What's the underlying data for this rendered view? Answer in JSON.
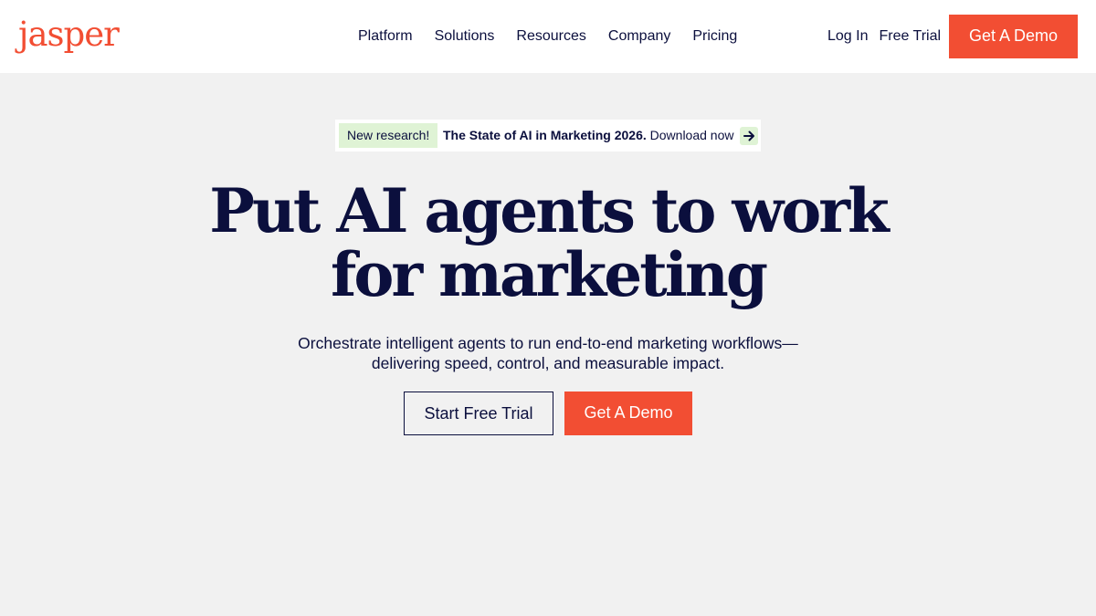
{
  "header": {
    "logo": "jasper",
    "nav": [
      "Platform",
      "Solutions",
      "Resources",
      "Company",
      "Pricing"
    ],
    "login": "Log In",
    "free_trial": "Free Trial",
    "demo": "Get A Demo"
  },
  "banner": {
    "badge": "New research!",
    "title": "The State of AI in Marketing 2026.",
    "link": "Download now",
    "icon": "arrow-right-icon"
  },
  "hero": {
    "headline_line1": "Put AI agents to work",
    "headline_line2": "for marketing",
    "sub_line1": "Orchestrate intelligent agents to run end-to-end marketing workflows—",
    "sub_line2": "delivering speed, control, and measurable impact.",
    "trial_button": "Start Free Trial",
    "demo_button": "Get A Demo"
  },
  "colors": {
    "accent": "#f24e33",
    "navy": "#0b0f3d",
    "background": "#f1f1f1",
    "badge": "#dff3d5"
  }
}
